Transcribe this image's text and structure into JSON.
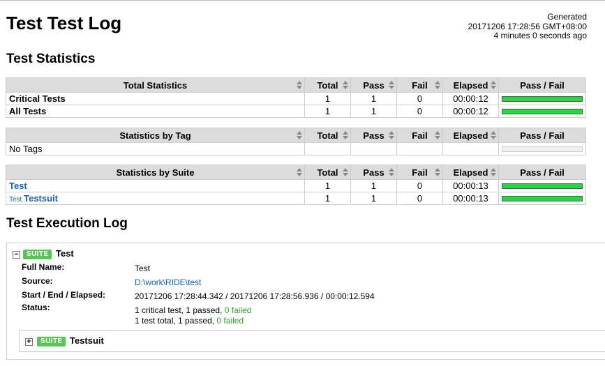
{
  "title": "Test Test Log",
  "generated": {
    "label": "Generated",
    "timestamp": "20171206 17:28:56 GMT+08:00",
    "ago": "4 minutes 0 seconds ago"
  },
  "statistics": {
    "heading": "Test Statistics",
    "columns": {
      "total": "Total",
      "pass": "Pass",
      "fail": "Fail",
      "elapsed": "Elapsed",
      "pass_fail": "Pass / Fail"
    },
    "total": {
      "header": "Total Statistics",
      "rows": [
        {
          "name": "Critical Tests",
          "total": "1",
          "pass": "1",
          "fail": "0",
          "elapsed": "00:00:12",
          "pass_ratio": 1
        },
        {
          "name": "All Tests",
          "total": "1",
          "pass": "1",
          "fail": "0",
          "elapsed": "00:00:12",
          "pass_ratio": 1
        }
      ]
    },
    "tag": {
      "header": "Statistics by Tag",
      "rows": [
        {
          "name": "No Tags",
          "total": "",
          "pass": "",
          "fail": "",
          "elapsed": "",
          "pass_ratio": 0
        }
      ]
    },
    "suite": {
      "header": "Statistics by Suite",
      "rows": [
        {
          "prefix": "",
          "name": "Test",
          "total": "1",
          "pass": "1",
          "fail": "0",
          "elapsed": "00:00:13",
          "pass_ratio": 1
        },
        {
          "prefix": "Test.",
          "name": "Testsuit",
          "total": "1",
          "pass": "1",
          "fail": "0",
          "elapsed": "00:00:13",
          "pass_ratio": 1
        }
      ]
    }
  },
  "execution_log": {
    "heading": "Test Execution Log",
    "suite": {
      "badge": "SUITE",
      "toggle": "−",
      "name": "Test",
      "labels": {
        "full_name": "Full Name:",
        "source": "Source:",
        "start_end": "Start / End / Elapsed:",
        "status": "Status:"
      },
      "full_name": "Test",
      "source": "D:\\work\\RIDE\\test",
      "start_end": "20171206 17:28:44.342 / 20171206 17:28:56.936 / 00:00:12.594",
      "status_line1_prefix": "1 critical test, 1 passed, ",
      "status_line1_failed": "0 failed",
      "status_line2_prefix": "1 test total, 1 passed, ",
      "status_line2_failed": "0 failed"
    },
    "child_suite": {
      "badge": "SUITE",
      "toggle": "+",
      "name": "Testsuit"
    }
  },
  "colors": {
    "pass_bar": "#1eda3c",
    "badge": "#57c454",
    "link": "#1a5fb4",
    "header_bg": "#dcdcdc"
  }
}
